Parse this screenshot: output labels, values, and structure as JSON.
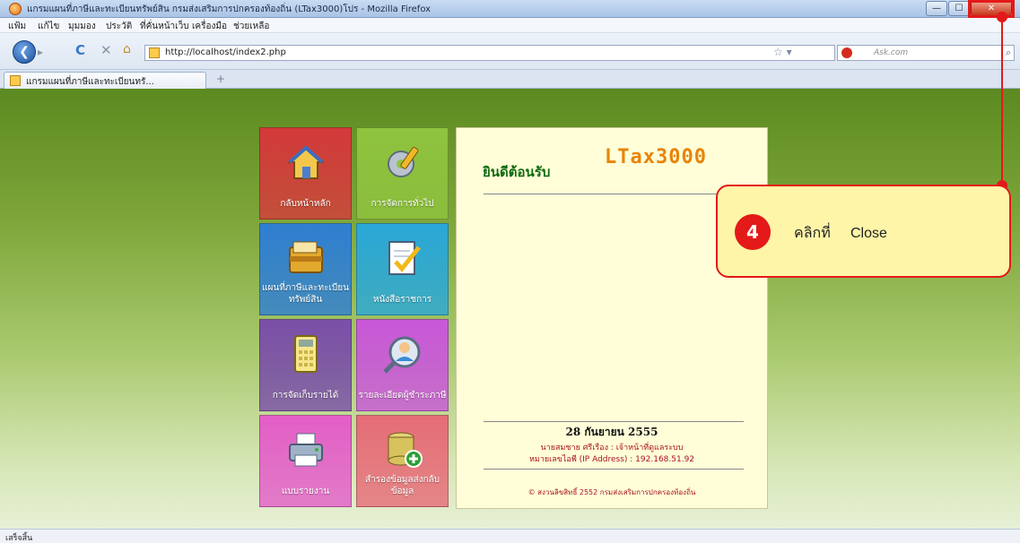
{
  "window": {
    "title": "แกรมแผนที่ภาษีและทะเบียนทรัพย์สิน กรมส่งเสริมการปกครองท้องถิ่น (LTax3000)โปร - Mozilla Firefox",
    "minimize_glyph": "—",
    "maximize_glyph": "☐",
    "close_glyph": "✕"
  },
  "menu": [
    "แฟ้ม",
    "แก้ไข",
    "มุมมอง",
    "ประวัติ",
    "ที่คั่นหน้าเว็บ",
    "เครื่องมือ",
    "ช่วยเหลือ"
  ],
  "nav": {
    "url": "http://localhost/index2.php",
    "search_placeholder": "Ask.com",
    "back_glyph": "❮",
    "forward_glyph": "▸",
    "reload_glyph": "C",
    "stop_glyph": "✕",
    "home_glyph": "⌂",
    "star_glyph": "☆ ▾",
    "search_go_glyph": "⌕"
  },
  "tabs": [
    {
      "label": "แกรมแผนที่ภาษีและทะเบียนทรั..."
    }
  ],
  "new_tab_glyph": "+",
  "menu_tiles": [
    {
      "label": "กลับหน้าหลัก",
      "color": "#d43a3a",
      "icon": "house-icon"
    },
    {
      "label": "การจัดการทั่วไป",
      "color": "#8fc43e",
      "icon": "gear-pencil-icon"
    },
    {
      "label": "แผนที่ภาษีและทะเบียนทรัพย์สิน",
      "color": "#2f7fd2",
      "icon": "folder-icon"
    },
    {
      "label": "หนังสือราชการ",
      "color": "#2aa8d8",
      "icon": "document-check-icon"
    },
    {
      "label": "การจัดเก็บรายได้",
      "color": "#7a4fa8",
      "icon": "calculator-icon"
    },
    {
      "label": "รายละเอียดผู้ชำระภาษี",
      "color": "#c957d9",
      "icon": "user-search-icon"
    },
    {
      "label": "แบบรายงาน",
      "color": "#e35fc8",
      "icon": "printer-icon"
    },
    {
      "label": "สำรองข้อมูลส่งกลับข้อมูล",
      "color": "#e66d78",
      "icon": "database-add-icon"
    }
  ],
  "panel": {
    "logo": "LTax3000",
    "welcome": "ยินดีต้อนรับ",
    "date": "28 กันยายน 2555",
    "user": "นายสมชาย ศรีเรือง : เจ้าหน้าที่ดูแลระบบ",
    "ip": "หมายเลขไอพี (IP Address) : 192.168.51.92",
    "copyright": "© สงวนลิขสิทธิ์ 2552 กรมส่งเสริมการปกครองท้องถิ่น"
  },
  "callout": {
    "number": "4",
    "text": "คลิกที่     Close"
  },
  "statusbar": {
    "text": "เสร็จสิ้น"
  },
  "colors": {
    "accent_red": "#e41919",
    "content_green": "#6e9a2c",
    "panel_bg": "#fffed8",
    "callout_bg": "#fff5a8"
  }
}
